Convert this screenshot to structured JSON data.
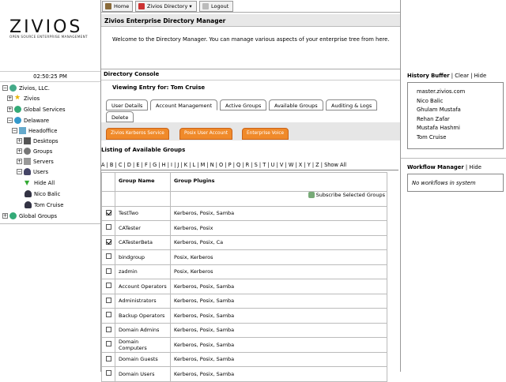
{
  "logo": {
    "name": "ZIVIOS",
    "tagline": "OPEN SOURCE ENTERPRISE MANAGEMENT"
  },
  "topnav": {
    "home": "Home",
    "directory": "Zivios Directory",
    "logout": "Logout"
  },
  "header": {
    "title": "Zivios Enterprise Directory Manager",
    "welcome": "Welcome to the Directory Manager. You can manage various aspects of your enterprise tree from here."
  },
  "clock": "02:50:25 PM",
  "tree": [
    {
      "label": "Zivios, LLC.",
      "toggle": "−"
    },
    {
      "label": "Zivios",
      "toggle": "+"
    },
    {
      "label": "Global Services",
      "toggle": "+"
    },
    {
      "label": "Delaware",
      "toggle": "−"
    },
    {
      "label": "Headoffice",
      "toggle": "−"
    },
    {
      "label": "Desktops",
      "toggle": "+"
    },
    {
      "label": "Groups",
      "toggle": "+"
    },
    {
      "label": "Servers",
      "toggle": "+"
    },
    {
      "label": "Users",
      "toggle": "−"
    },
    {
      "label": "Hide All",
      "toggle": ""
    },
    {
      "label": "Nico Balic",
      "toggle": ""
    },
    {
      "label": "Tom Cruise",
      "toggle": ""
    },
    {
      "label": "Global Groups",
      "toggle": "+"
    }
  ],
  "console": {
    "title": "Directory Console",
    "viewing": "Viewing Entry for: Tom Cruise",
    "tabs": [
      "User Details",
      "Account Management",
      "Active Groups",
      "Available Groups",
      "Auditing & Logs",
      "Delete"
    ],
    "subtabs": [
      "Zivios Kerberos Service",
      "Posix User Account",
      "Enterprise Voice"
    ],
    "list_title": "Listing of Available Groups",
    "alphabet": "A | B | C | D | E | F | G | H | I | J | K | L | M | N | O | P | Q | R | S | T | U | V | W | X | Y | Z | Show All",
    "col_name": "Group Name",
    "col_plugins": "Group Plugins",
    "subscribe": "Subscribe Selected Groups",
    "rows": [
      {
        "name": "TestTwo",
        "plugins": "Kerberos, Posix, Samba",
        "checked": true
      },
      {
        "name": "CATester",
        "plugins": "Kerberos, Posix",
        "checked": false
      },
      {
        "name": "CATesterBeta",
        "plugins": "Kerberos, Posix, Ca",
        "checked": true
      },
      {
        "name": "bindgroup",
        "plugins": "Posix, Kerberos",
        "checked": false
      },
      {
        "name": "zadmin",
        "plugins": "Posix, Kerberos",
        "checked": false
      },
      {
        "name": "Account Operators",
        "plugins": "Kerberos, Posix, Samba",
        "checked": false
      },
      {
        "name": "Administrators",
        "plugins": "Kerberos, Posix, Samba",
        "checked": false
      },
      {
        "name": "Backup Operators",
        "plugins": "Kerberos, Posix, Samba",
        "checked": false
      },
      {
        "name": "Domain Admins",
        "plugins": "Kerberos, Posix, Samba",
        "checked": false
      },
      {
        "name": "Domain Computers",
        "plugins": "Kerberos, Posix, Samba",
        "checked": false
      },
      {
        "name": "Domain Guests",
        "plugins": "Kerberos, Posix, Samba",
        "checked": false
      },
      {
        "name": "Domain Users",
        "plugins": "Kerberos, Posix, Samba",
        "checked": false
      }
    ]
  },
  "history": {
    "title": "History Buffer",
    "clear": "Clear",
    "hide": "Hide",
    "items": [
      "master.zivios.com",
      "Nico Balic",
      "Ghulam Mustafa",
      "Rehan Zafar",
      "Mustafa Hashmi",
      "Tom Cruise"
    ]
  },
  "workflow": {
    "title": "Workflow Manager",
    "hide": "Hide",
    "empty": "No workflows in system"
  }
}
